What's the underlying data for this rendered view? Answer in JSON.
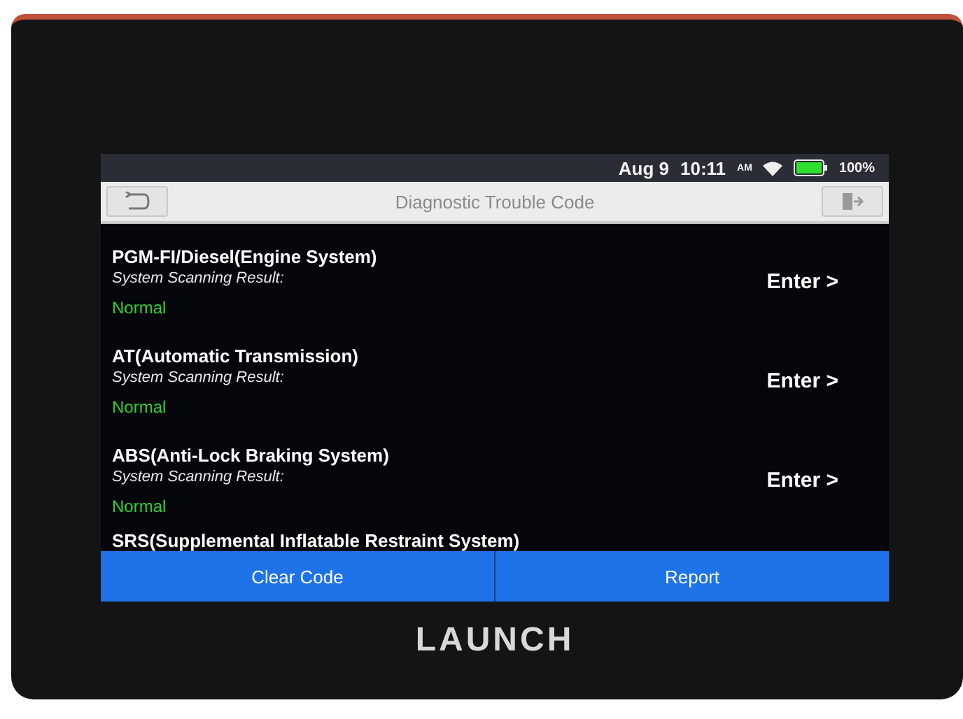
{
  "status_bar": {
    "date": "Aug 9",
    "time": "10:11",
    "meridiem": "AM",
    "battery": "100%"
  },
  "title_bar": {
    "title": "Diagnostic Trouble Code"
  },
  "systems": [
    {
      "name": "PGM-FI/Diesel(Engine System)",
      "label": "System Scanning Result:",
      "result": "Normal",
      "action": "Enter >"
    },
    {
      "name": "AT(Automatic Transmission)",
      "label": "System Scanning Result:",
      "result": "Normal",
      "action": "Enter >"
    },
    {
      "name": "ABS(Anti-Lock Braking System)",
      "label": "System Scanning Result:",
      "result": "Normal",
      "action": "Enter >"
    },
    {
      "name": "SRS(Supplemental Inflatable Restraint System)"
    }
  ],
  "buttons": [
    "Clear Code",
    "Report"
  ],
  "brand": "LAUNCH"
}
